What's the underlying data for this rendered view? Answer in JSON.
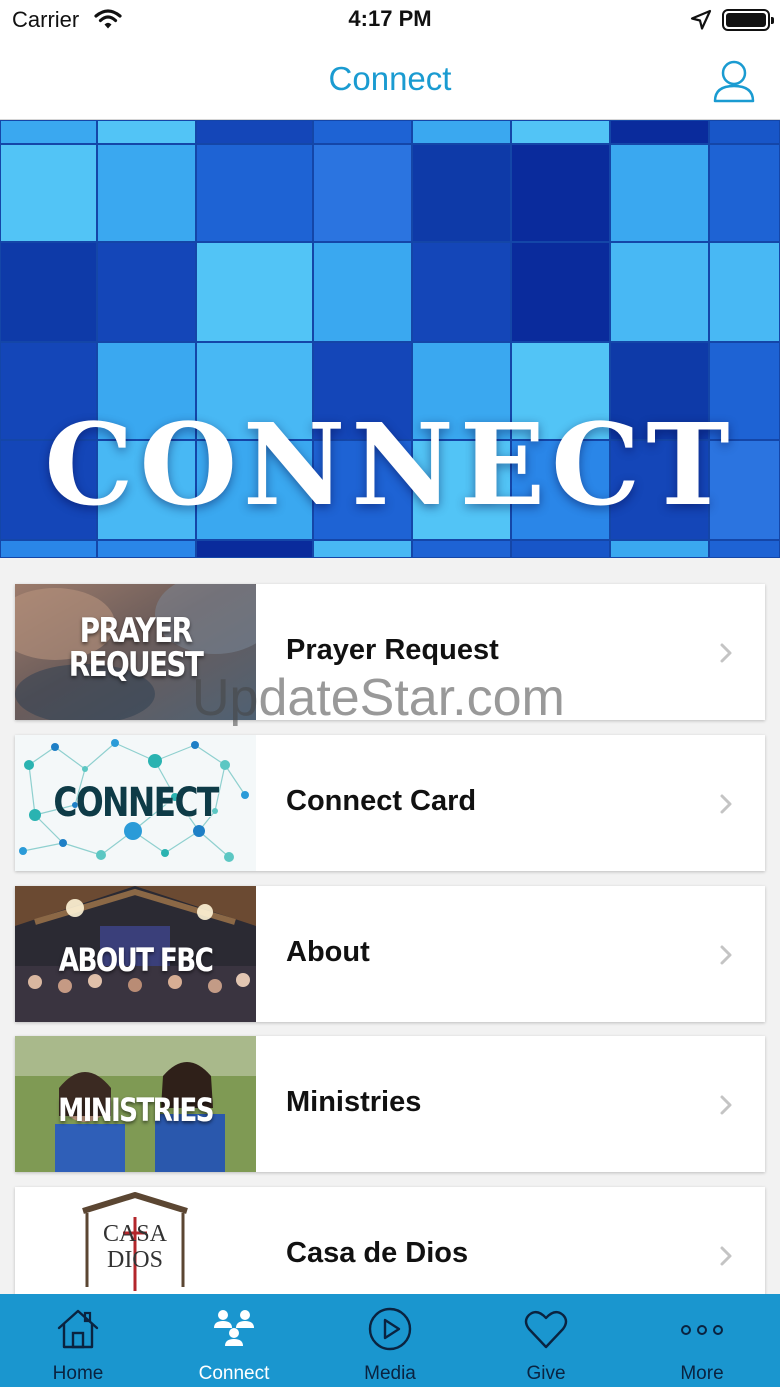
{
  "status_bar": {
    "carrier": "Carrier",
    "time": "4:17 PM"
  },
  "nav": {
    "title": "Connect"
  },
  "hero": {
    "title": "CONNECT"
  },
  "items": [
    {
      "thumb_text_1": "PRAYER",
      "thumb_text_2": "REQUEST",
      "label": "Prayer Request"
    },
    {
      "thumb_text_1": "CONNECT",
      "label": "Connect Card"
    },
    {
      "thumb_text_1": "ABOUT FBC",
      "label": "About"
    },
    {
      "thumb_text_1": "MINISTRIES",
      "label": "Ministries"
    },
    {
      "logo_text_1": "CASA",
      "logo_text_2": "DIOS",
      "label": "Casa de Dios"
    }
  ],
  "watermark": "UpdateStar.com",
  "tabs": [
    {
      "label": "Home",
      "icon": "home-icon"
    },
    {
      "label": "Connect",
      "icon": "people-icon",
      "active": true
    },
    {
      "label": "Media",
      "icon": "play-circle-icon"
    },
    {
      "label": "Give",
      "icon": "heart-icon"
    },
    {
      "label": "More",
      "icon": "ellipsis-icon"
    }
  ],
  "colors": {
    "accent": "#1a9bd1",
    "tab_bar": "#1a96cf",
    "tab_active": "#ffffff",
    "tab_inactive": "#0a2340"
  }
}
